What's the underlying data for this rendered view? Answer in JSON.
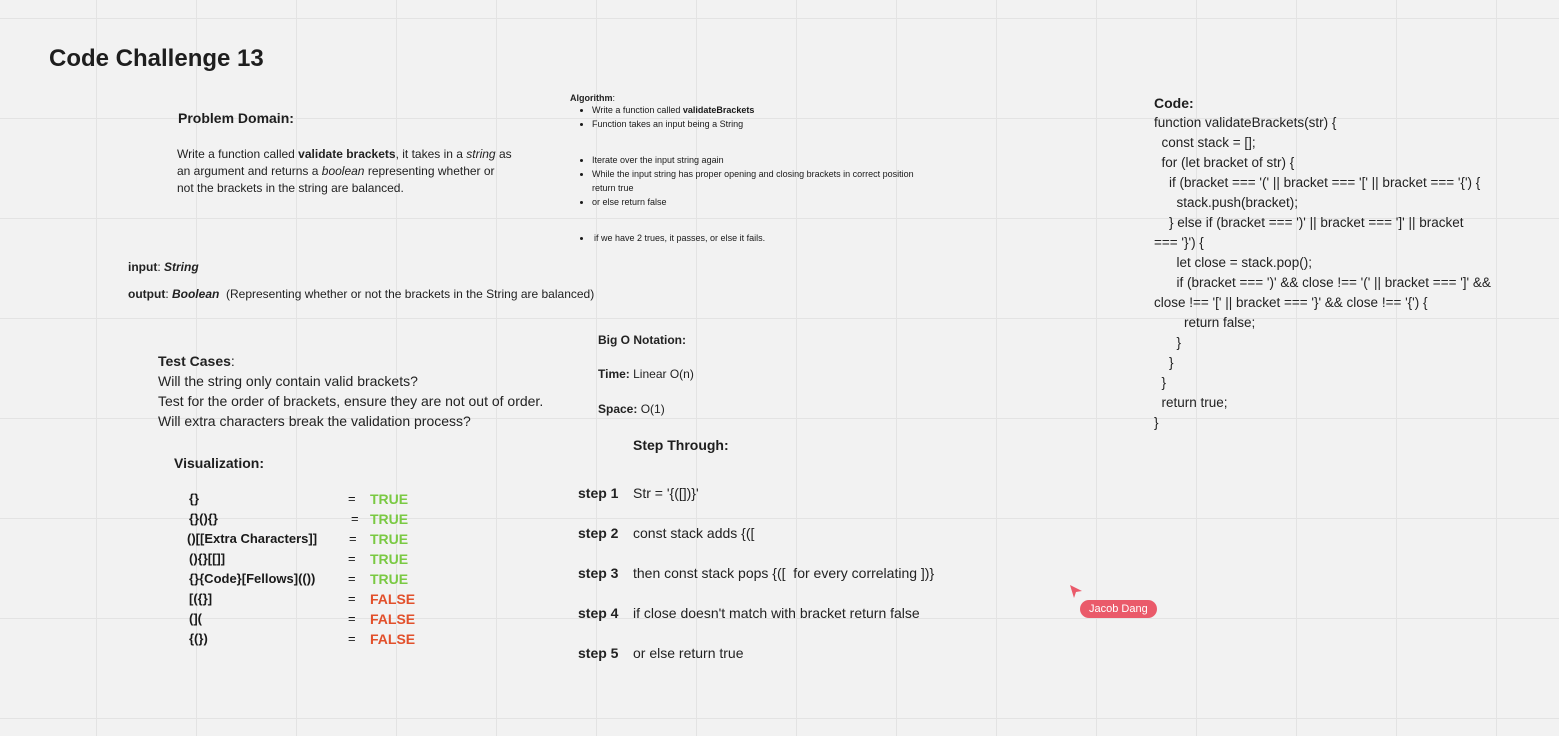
{
  "board": {
    "title": "Code Challenge 13"
  },
  "problem": {
    "heading": "Problem  Domain:",
    "line1_pre": "Write a function called ",
    "line1_bold": "validate brackets",
    "line1_mid": ", it takes in a ",
    "line1_italic": "string",
    "line1_post": " as",
    "line2_pre": "an argument and returns a ",
    "line2_italic": "boolean",
    "line2_post": " representing whether or",
    "line3": "not the brackets in the string are balanced."
  },
  "io": {
    "input_label": "input",
    "input_sep": ": ",
    "input_value": "String",
    "output_label": "output",
    "output_sep": ": ",
    "output_value": "Boolean",
    "output_note": "  (Representing whether or not the brackets in the String are balanced)"
  },
  "algorithm": {
    "heading": "Algorithm",
    "colon": ":",
    "item1_pre": "Write a function called ",
    "item1_bold": "validateBrackets",
    "item2": "Function takes an input being a String",
    "item3": "Iterate over the input string again",
    "item4": "While the input string has proper opening and closing brackets in correct position",
    "item4b": "return true",
    "item5": "or else return false",
    "item6": "if we have 2 trues, it passes, or else it fails."
  },
  "test_cases": {
    "heading": "Test Cases",
    "colon": ":",
    "lines": [
      "Will the string only contain valid brackets?",
      "Test for the order of brackets, ensure they are not out of order.",
      "Will extra characters break the validation process?"
    ]
  },
  "visualization": {
    "heading": "Visualization:",
    "rows": [
      {
        "expr": "{}",
        "eq": "=",
        "result": "TRUE"
      },
      {
        "expr": "{}(){}",
        "eq": "=",
        "result": "TRUE"
      },
      {
        "expr": "()[[Extra Characters]]",
        "eq": "=",
        "result": "TRUE"
      },
      {
        "expr": "(){}[[]]",
        "eq": "=",
        "result": "TRUE"
      },
      {
        "expr": "{}{Code}[Fellows](())",
        "eq": "=",
        "result": "TRUE"
      },
      {
        "expr": "[({}]",
        "eq": "=",
        "result": "FALSE"
      },
      {
        "expr": "(](",
        "eq": "=",
        "result": "FALSE"
      },
      {
        "expr": "{(})",
        "eq": "=",
        "result": "FALSE"
      }
    ],
    "colors": {
      "true": "#7ac943",
      "false": "#e2502b"
    }
  },
  "big_o": {
    "heading": "Big O Notation:",
    "time_label": "Time:",
    "time_value": " Linear O(n)",
    "space_label": "Space:",
    "space_value": " O(1)"
  },
  "step_through": {
    "heading": "Step Through:",
    "steps": [
      {
        "label": "step 1",
        "text": "Str = '{([])}'"
      },
      {
        "label": "step 2",
        "text": "const stack  adds {(["
      },
      {
        "label": "step 3",
        "text": "then const stack pops {([  for every correlating ])}"
      },
      {
        "label": "step 4",
        "text": "if close doesn't match with bracket return false"
      },
      {
        "label": "step 5",
        "text": "or else return true"
      }
    ]
  },
  "code": {
    "heading": "Code:",
    "lines": [
      "function validateBrackets(str) {",
      "  const stack = [];",
      "",
      "  for (let bracket of str) {",
      "    if (bracket === '(' || bracket === '[' || bracket === '{') {",
      "      stack.push(bracket);",
      "    } else if (bracket === ')' || bracket === ']' || bracket",
      "=== '}') {",
      "      let close = stack.pop();",
      "      if (bracket === ')' && close !== '(' || bracket === ']' &&",
      "close !== '[' || bracket === '}' && close !== '{') {",
      "        return false;",
      "      }",
      "    }",
      "  }",
      "",
      "  return true;",
      "}"
    ]
  },
  "collaborator": {
    "name": "Jacob Dang",
    "color": "#ea5a6a"
  }
}
